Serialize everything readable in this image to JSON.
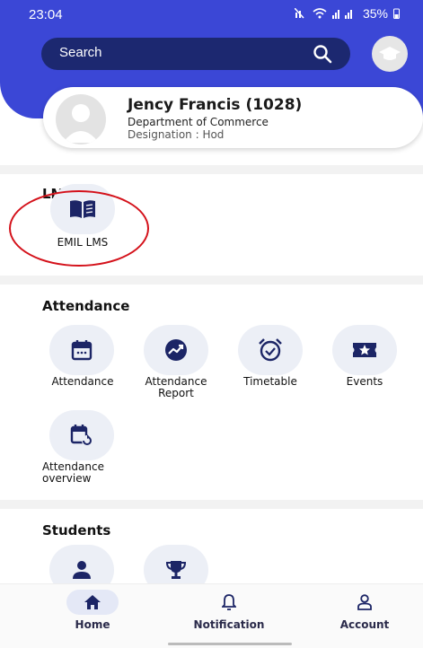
{
  "status_bar": {
    "time": "23:04",
    "battery": "35%"
  },
  "header": {
    "search_label": "Search"
  },
  "profile": {
    "name": "Jency Francis (1028)",
    "department": "Department of Commerce",
    "designation": "Designation : Hod"
  },
  "sections": {
    "lms": {
      "title": "LMS",
      "items": [
        {
          "label": "EMIL LMS",
          "icon": "book-icon"
        }
      ]
    },
    "attendance": {
      "title": "Attendance",
      "items": [
        {
          "label": "Attendance",
          "icon": "calendar-icon"
        },
        {
          "label": "Attendance Report",
          "icon": "trend-chart-icon"
        },
        {
          "label": "Timetable",
          "icon": "alarm-clock-icon"
        },
        {
          "label": "Events",
          "icon": "star-ticket-icon"
        },
        {
          "label": "Attendance overview",
          "icon": "calendar-refresh-icon"
        }
      ]
    },
    "students": {
      "title": "Students",
      "items": [
        {
          "icon": "person-icon"
        },
        {
          "icon": "trophy-icon"
        }
      ]
    }
  },
  "bottom_nav": [
    {
      "label": "Home",
      "icon": "home-icon",
      "active": true
    },
    {
      "label": "Notification",
      "icon": "bell-icon",
      "active": false
    },
    {
      "label": "Account",
      "icon": "account-icon",
      "active": false
    }
  ],
  "colors": {
    "header": "#3b47d6",
    "search_bar": "#1c2870",
    "icon_navy": "#1c2566",
    "tile_bg": "#eceff6",
    "annotation_circle": "#d4111a"
  }
}
